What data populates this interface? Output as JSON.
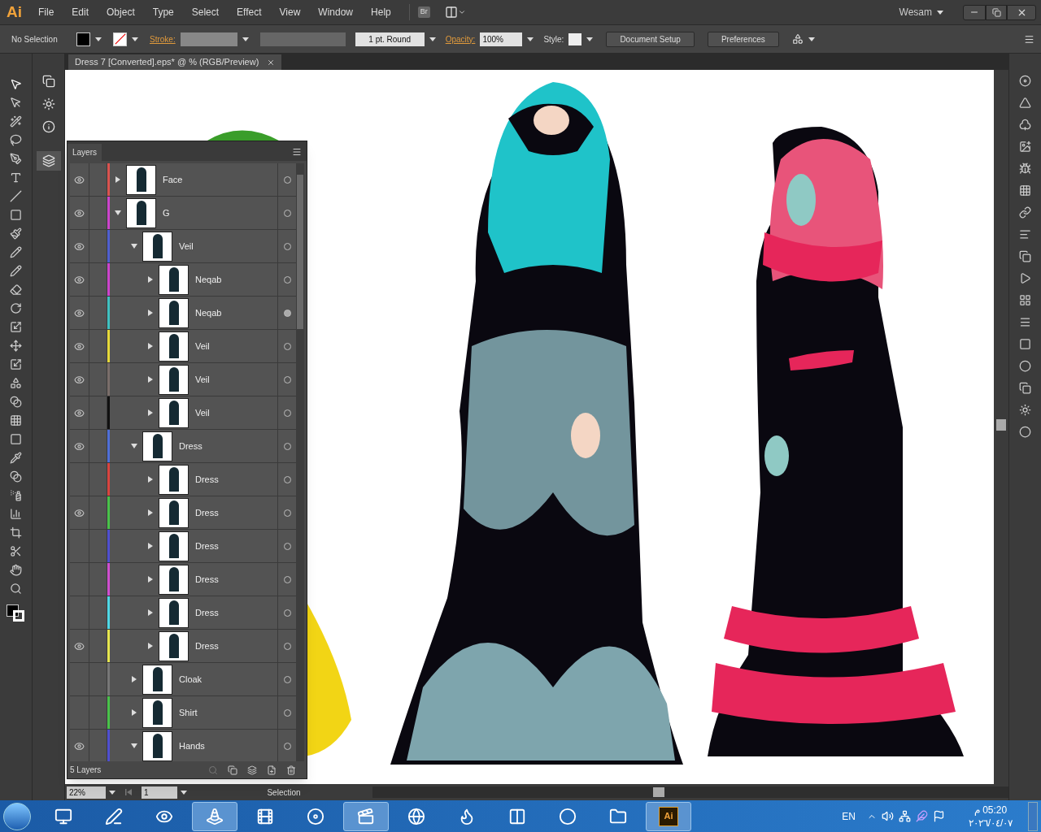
{
  "app": {
    "logo": "Ai",
    "menu": [
      "File",
      "Edit",
      "Object",
      "Type",
      "Select",
      "Effect",
      "View",
      "Window",
      "Help"
    ],
    "bridge": "Br",
    "workspace": "Wesam"
  },
  "control_bar": {
    "selection": "No Selection",
    "stroke_label": "Stroke:",
    "brush": "1 pt. Round",
    "opacity_label": "Opacity:",
    "opacity": "100%",
    "style_label": "Style:",
    "buttons": [
      "Document Setup",
      "Preferences"
    ]
  },
  "document_tab": {
    "title": "Dress 7 [Converted].eps* @ % (RGB/Preview)",
    "selected": true
  },
  "layers_panel": {
    "title": "Layers",
    "layers": [
      {
        "name": "Face",
        "color": "#d9534f",
        "visible": true,
        "expanded": false,
        "targeted": false
      },
      {
        "name": "G",
        "color": "#cc44cc",
        "visible": true,
        "expanded": true,
        "targeted": false,
        "children": [
          {
            "name": "Veil",
            "color": "#4f5fd0",
            "visible": true,
            "expanded": true,
            "targeted": false,
            "children": [
              {
                "name": "Neqab",
                "color": "#cc44cc",
                "visible": true,
                "expanded": false,
                "targeted": false
              },
              {
                "name": "Neqab",
                "color": "#3fc1c1",
                "visible": true,
                "expanded": false,
                "targeted": true
              },
              {
                "name": "Veil",
                "color": "#e6d93a",
                "visible": true,
                "expanded": false,
                "targeted": false
              },
              {
                "name": "Veil",
                "color": "#7a6e6a",
                "visible": true,
                "expanded": false,
                "targeted": false
              },
              {
                "name": "Veil",
                "color": "#111111",
                "visible": true,
                "expanded": false,
                "targeted": false
              }
            ]
          },
          {
            "name": "Dress",
            "color": "#4f6fd8",
            "visible": true,
            "expanded": true,
            "targeted": false,
            "children": [
              {
                "name": "Dress",
                "color": "#d9443f",
                "visible": false,
                "expanded": false,
                "targeted": false
              },
              {
                "name": "Dress",
                "color": "#49c24a",
                "visible": true,
                "expanded": false,
                "targeted": false
              },
              {
                "name": "Dress",
                "color": "#4f4fd0",
                "visible": false,
                "expanded": false,
                "targeted": false
              },
              {
                "name": "Dress",
                "color": "#d04fd0",
                "visible": false,
                "expanded": false,
                "targeted": false
              },
              {
                "name": "Dress",
                "color": "#4fd8e6",
                "visible": false,
                "expanded": false,
                "targeted": false
              },
              {
                "name": "Dress",
                "color": "#e6e64f",
                "visible": true,
                "expanded": false,
                "targeted": false
              }
            ]
          },
          {
            "name": "Cloak",
            "color": "#777777",
            "visible": false,
            "expanded": false,
            "targeted": false
          },
          {
            "name": "Shirt",
            "color": "#49c24a",
            "visible": false,
            "expanded": false,
            "targeted": false
          },
          {
            "name": "Hands",
            "color": "#4f4fd0",
            "visible": true,
            "expanded": true,
            "targeted": false
          }
        ]
      }
    ],
    "footer": "5 Layers"
  },
  "status_bar": {
    "zoom": "22%",
    "artboard": "1",
    "tool": "Selection"
  },
  "taskbar": {
    "apps": [
      {
        "active": false
      },
      {
        "active": false
      },
      {
        "active": false
      },
      {
        "active": true
      },
      {
        "active": false
      },
      {
        "active": false
      },
      {
        "active": true
      },
      {
        "active": false
      },
      {
        "active": false
      },
      {
        "active": false
      },
      {
        "active": false
      },
      {
        "active": false
      },
      {
        "active": true,
        "label": "Ai"
      }
    ],
    "language": "EN",
    "time": "05:20 م",
    "date": "٢٠٢٦/٠٤/٠٧"
  }
}
